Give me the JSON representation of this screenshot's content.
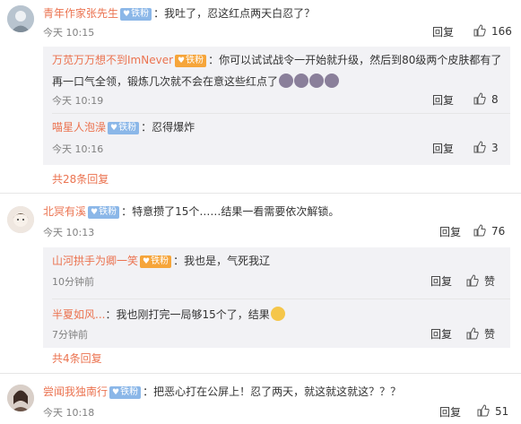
{
  "ui": {
    "reply": "回复",
    "like_icon": "thumb-up-icon",
    "badge_icon": "heart-icon"
  },
  "comments": [
    {
      "user": "青年作家张先生",
      "badge": "铁粉",
      "colon": "：",
      "text": "我吐了，忍这红点两天白忍了？",
      "time": "今天 10:15",
      "likes": "166",
      "replies": [
        {
          "user": "万苋万万想不到ImNever",
          "badge": "铁粉",
          "colon": "：",
          "text_line1": "你可以试试战令一开始就升级，然后到80级两个皮肤都有了",
          "text_line2": "再一口气全领，锻炼几次就不会在意这些红点了",
          "time": "今天 10:19",
          "likes": "8"
        },
        {
          "user": "喵星人泡澡",
          "badge": "铁粉",
          "colon": "：",
          "text": "忍得爆炸",
          "time": "今天 10:16",
          "likes": "3"
        }
      ],
      "more": "共28条回复"
    },
    {
      "user": "北冥有溪",
      "badge": "铁粉",
      "colon": "：",
      "text": "特意攒了15个……结果一看需要依次解锁。",
      "time": "今天 10:13",
      "likes": "76",
      "replies": [
        {
          "user": "山河拱手为卿一笑",
          "badge": "铁粉",
          "colon": "：",
          "text": "我也是，气死我辽",
          "time": "10分钟前",
          "likes": "赞"
        },
        {
          "user": "半夏如风...",
          "colon": "：",
          "text": "我也刚打完一局够15个了，结果",
          "time": "7分钟前",
          "likes": "赞"
        }
      ],
      "more": "共4条回复"
    },
    {
      "user": "尝闻我独南行",
      "badge": "铁粉",
      "colon": "：",
      "text": "把恶心打在公屏上！忍了两天，就这就这就这？？？",
      "time": "今天 10:18",
      "likes": "51"
    }
  ]
}
